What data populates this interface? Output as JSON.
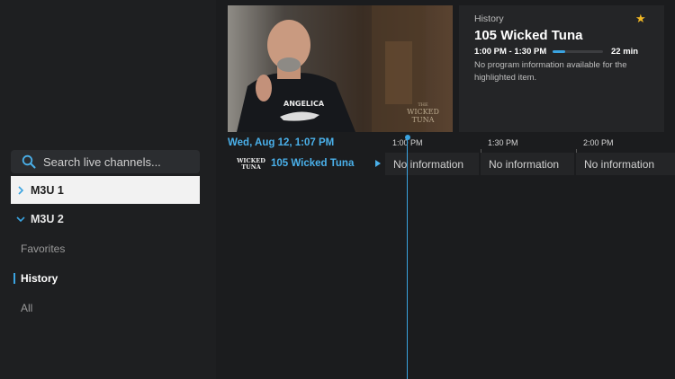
{
  "search": {
    "placeholder": "Search live channels..."
  },
  "groups": [
    {
      "label": "M3U 1",
      "expanded": false,
      "selected": true
    },
    {
      "label": "M3U 2",
      "expanded": true,
      "selected": false
    }
  ],
  "subitems": [
    {
      "label": "Favorites",
      "active": false
    },
    {
      "label": "History",
      "active": true
    },
    {
      "label": "All",
      "active": false
    }
  ],
  "program": {
    "category": "History",
    "title": "105 Wicked Tuna",
    "time_range": "1:00 PM - 1:30 PM",
    "duration": "22 min",
    "progress": 0.25,
    "description": "No program information available for the highlighted item.",
    "favorite_icon": "star-icon"
  },
  "preview": {
    "watermark_line1": "THE",
    "watermark_line2": "WICKED",
    "watermark_line3": "TUNA",
    "shirt_text": "ANGELICA"
  },
  "guide": {
    "now": "Wed, Aug 12, 1:07 PM",
    "ticks": [
      "1:00 PM",
      "1:30 PM",
      "2:00 PM"
    ],
    "channel": {
      "logo_text_1": "WICKED",
      "logo_text_2": "TUNA",
      "name": "105 Wicked Tuna",
      "cells": [
        "No information",
        "No information",
        "No information"
      ]
    }
  },
  "colors": {
    "accent": "#3aa3e0",
    "star": "#f2b824"
  }
}
